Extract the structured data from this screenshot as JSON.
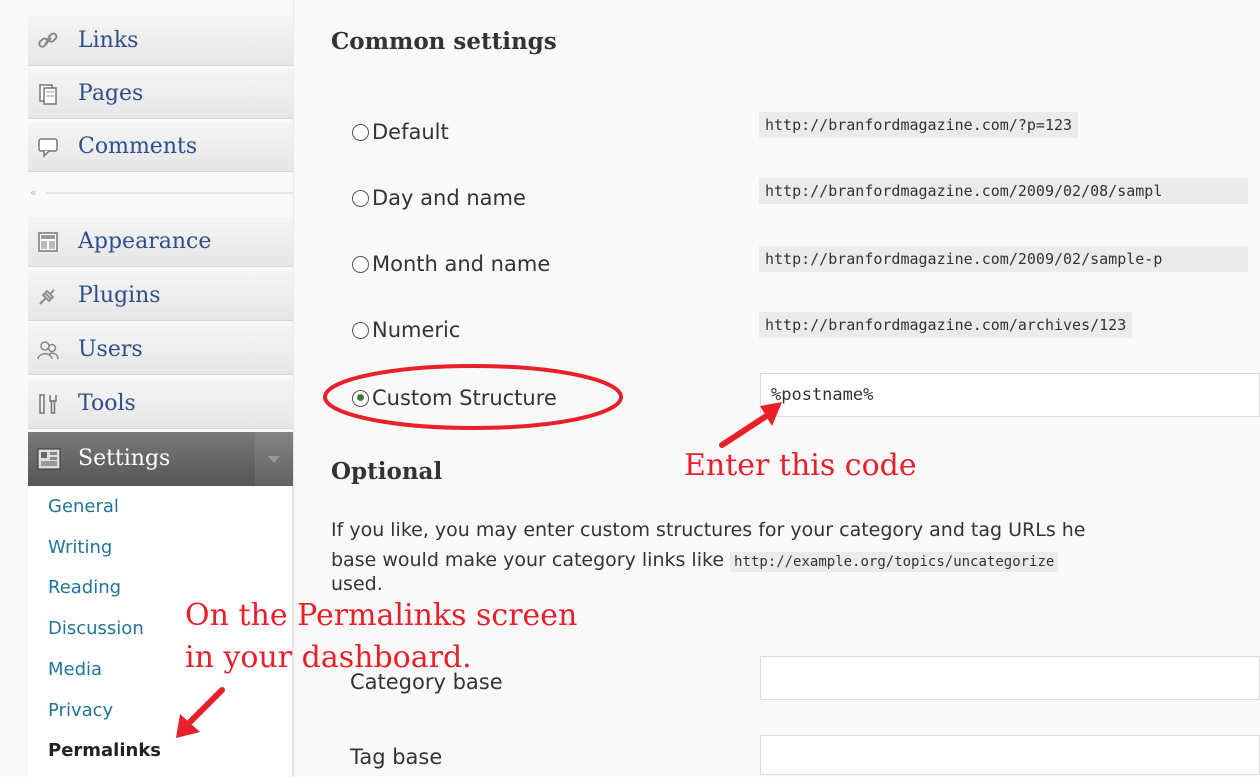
{
  "sidebar": {
    "menu": [
      {
        "label": "Links",
        "icon": "link-icon"
      },
      {
        "label": "Pages",
        "icon": "pages-icon"
      },
      {
        "label": "Comments",
        "icon": "comment-icon"
      },
      {
        "label": "Appearance",
        "icon": "appearance-icon"
      },
      {
        "label": "Plugins",
        "icon": "plugin-icon"
      },
      {
        "label": "Users",
        "icon": "users-icon"
      },
      {
        "label": "Tools",
        "icon": "tools-icon"
      }
    ],
    "settings": {
      "label": "Settings",
      "icon": "settings-icon"
    },
    "submenu": [
      {
        "label": "General"
      },
      {
        "label": "Writing"
      },
      {
        "label": "Reading"
      },
      {
        "label": "Discussion"
      },
      {
        "label": "Media"
      },
      {
        "label": "Privacy"
      },
      {
        "label": "Permalinks"
      }
    ]
  },
  "main": {
    "common_settings_title": "Common settings",
    "options": [
      {
        "label": "Default",
        "example": "http://branfordmagazine.com/?p=123",
        "checked": false
      },
      {
        "label": "Day and name",
        "example": "http://branfordmagazine.com/2009/02/08/sampl",
        "checked": false
      },
      {
        "label": "Month and name",
        "example": "http://branfordmagazine.com/2009/02/sample-p",
        "checked": false
      },
      {
        "label": "Numeric",
        "example": "http://branfordmagazine.com/archives/123",
        "checked": false
      },
      {
        "label": "Custom Structure",
        "checked": true
      }
    ],
    "custom_structure_value": "%postname%",
    "optional_title": "Optional",
    "description": {
      "line1": "If you like, you may enter custom structures for your category and tag URLs he",
      "line2_text": "base would make your category links like ",
      "line2_code": "http://example.org/topics/uncategorize",
      "line3": "used."
    },
    "category_base_label": "Category base",
    "tag_base_label": "Tag base",
    "category_base_value": "",
    "tag_base_value": ""
  },
  "annotations": {
    "enter_code": "Enter this code",
    "permalinks_line1": "On the Permalinks screen",
    "permalinks_line2": "in your dashboard.",
    "color": "#e8202a"
  },
  "colors": {
    "link": "#21759b",
    "menu_text": "#2d4e8a",
    "settings_bg": "#666666",
    "accent_red": "#e8202a"
  }
}
